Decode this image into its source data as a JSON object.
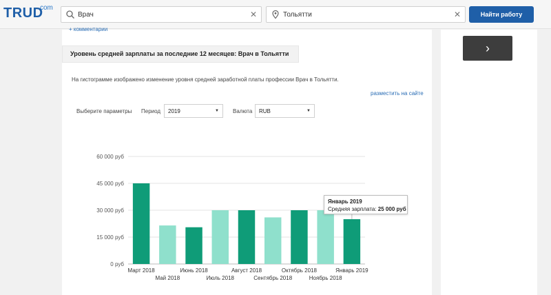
{
  "header": {
    "logo_text": "TRUD",
    "logo_sup": "com",
    "search": {
      "value": "Врач",
      "icon": "search-icon"
    },
    "city": {
      "value": "Тольятти",
      "icon": "location-pin-icon"
    },
    "find_button": "Найти работу"
  },
  "content": {
    "comments_link": "+ комментарии",
    "heading": "Уровень средней зарплаты за последние 12 месяцев: Врач в Тольятти",
    "description": "На гистограмме изображено изменение уровня средней заработной платы профессии Врач в Тольятти.",
    "embed_link": "разместить на сайте",
    "params_label": "Выберите параметры",
    "period_label": "Период",
    "period_value": "2019",
    "currency_label": "Валюта",
    "currency_value": "RUB"
  },
  "chart_data": {
    "type": "bar",
    "categories": [
      "Март 2018",
      "Май 2018",
      "Июнь 2018",
      "Июль 2018",
      "Август 2018",
      "Сентябрь 2018",
      "Октябрь 2018",
      "Ноябрь 2018",
      "Январь 2019"
    ],
    "values": [
      45000,
      21500,
      20500,
      30000,
      30000,
      26000,
      30000,
      30000,
      25000
    ],
    "yticks": [
      "0 руб",
      "15 000 руб",
      "30 000 руб",
      "45 000 руб",
      "60 000 руб"
    ],
    "ylim": [
      0,
      60000
    ],
    "grid": true,
    "colors": {
      "dark": "#0f9c78",
      "light": "#8fe0cc"
    },
    "bar_shades": [
      "dark",
      "light",
      "dark",
      "light",
      "dark",
      "light",
      "dark",
      "light",
      "dark"
    ],
    "tooltip": {
      "title": "Январь 2019",
      "label": "Средняя зарплата:",
      "value": "25 000 руб"
    }
  }
}
